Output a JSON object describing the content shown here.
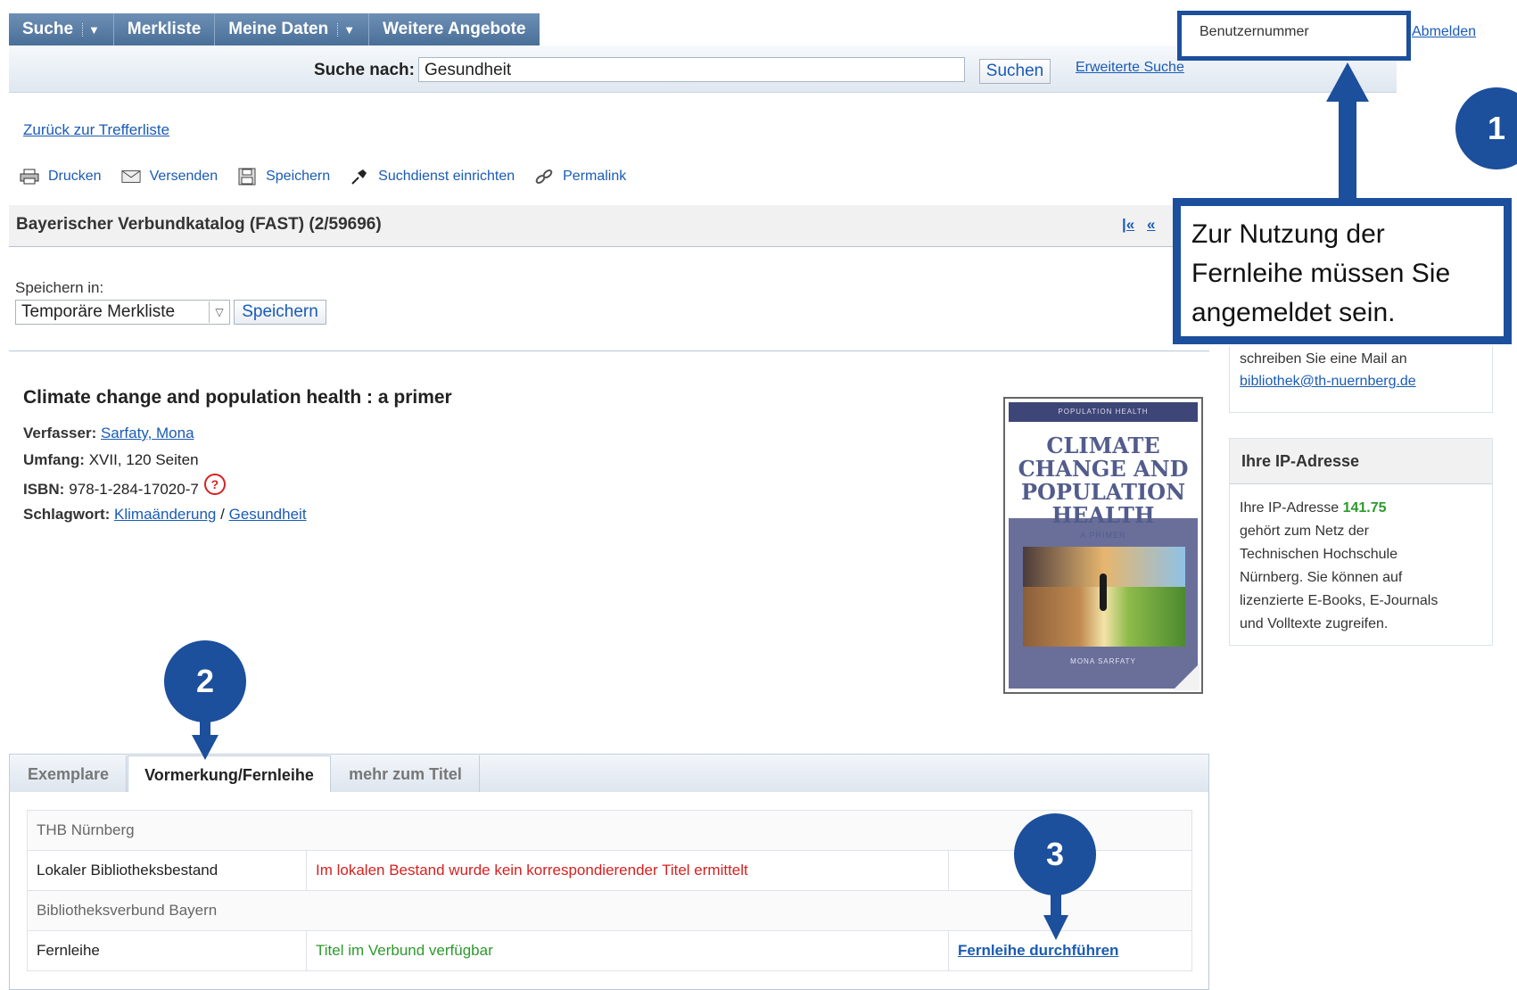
{
  "nav": {
    "items": [
      {
        "label": "Suche",
        "dropdown": true
      },
      {
        "label": "Merkliste",
        "dropdown": false
      },
      {
        "label": "Meine Daten",
        "dropdown": true
      },
      {
        "label": "Weitere Angebote",
        "dropdown": false
      }
    ]
  },
  "search": {
    "label": "Suche nach:",
    "value": "Gesundheit",
    "button": "Suchen",
    "advanced": "Erweiterte Suche"
  },
  "user": {
    "label": "Benutzernummer",
    "logout": "Abmelden"
  },
  "back_link": "Zurück zur Trefferliste",
  "toolbar": {
    "print": "Drucken",
    "send": "Versenden",
    "save": "Speichern",
    "alert": "Suchdienst einrichten",
    "permalink": "Permalink"
  },
  "catalog": {
    "title": "Bayerischer Verbundkatalog (FAST) (2/59696)",
    "nav_first": "|«",
    "nav_prev": "«"
  },
  "save_in": {
    "label": "Speichern in:",
    "selected": "Temporäre Merkliste",
    "button": "Speichern"
  },
  "record": {
    "title": "Climate change and population health : a primer",
    "author_label": "Verfasser:",
    "author": "Sarfaty, Mona",
    "extent_label": "Umfang:",
    "extent": "XVII, 120 Seiten",
    "isbn_label": "ISBN:",
    "isbn": "978-1-284-17020-7",
    "subject_label": "Schlagwort:",
    "subject_1": "Klimaänderung",
    "subject_sep": "/",
    "subject_2": "Gesundheit"
  },
  "cover": {
    "series": "POPULATION HEALTH",
    "line1": "CLIMATE",
    "line2": "CHANGE AND",
    "line3": "POPULATION",
    "line4": "HEALTH",
    "subtitle": "A PRIMER",
    "author": "MONA SARFATY"
  },
  "sidebar": {
    "contact_line": "schreiben Sie eine Mail an",
    "contact_email": "bibliothek@th-nuernberg.de",
    "ip_heading": "Ihre IP-Adresse",
    "ip_prefix": "Ihre IP-Adresse",
    "ip_value": "141.75",
    "ip_text_1": "gehört zum Netz der",
    "ip_text_2": "Technischen Hochschule",
    "ip_text_3": "Nürnberg. Sie können auf",
    "ip_text_4": "lizenzierte E-Books, E-Journals",
    "ip_text_5": "und Volltexte zugreifen."
  },
  "tabs": [
    {
      "label": "Exemplare",
      "active": false
    },
    {
      "label": "Vormerkung/Fernleihe",
      "active": true
    },
    {
      "label": "mehr zum Titel",
      "active": false
    }
  ],
  "holdings": {
    "section1": "THB Nürnberg",
    "row1_label": "Lokaler Bibliotheksbestand",
    "row1_status": "Im lokalen Bestand wurde kein korrespondierender Titel ermittelt",
    "section2": "Bibliotheksverbund Bayern",
    "row2_label": "Fernleihe",
    "row2_status": "Titel im Verbund verfügbar",
    "row2_action": "Fernleihe durchführen"
  },
  "annotations": {
    "callout": "Zur Nutzung der Fernleihe müssen Sie angemeldet sein.",
    "badge1": "1",
    "badge2": "2",
    "badge3": "3"
  },
  "colors": {
    "accent": "#1c4f9c",
    "error": "#d62020",
    "ok": "#2c9a2c",
    "link": "#1a5bb5"
  }
}
